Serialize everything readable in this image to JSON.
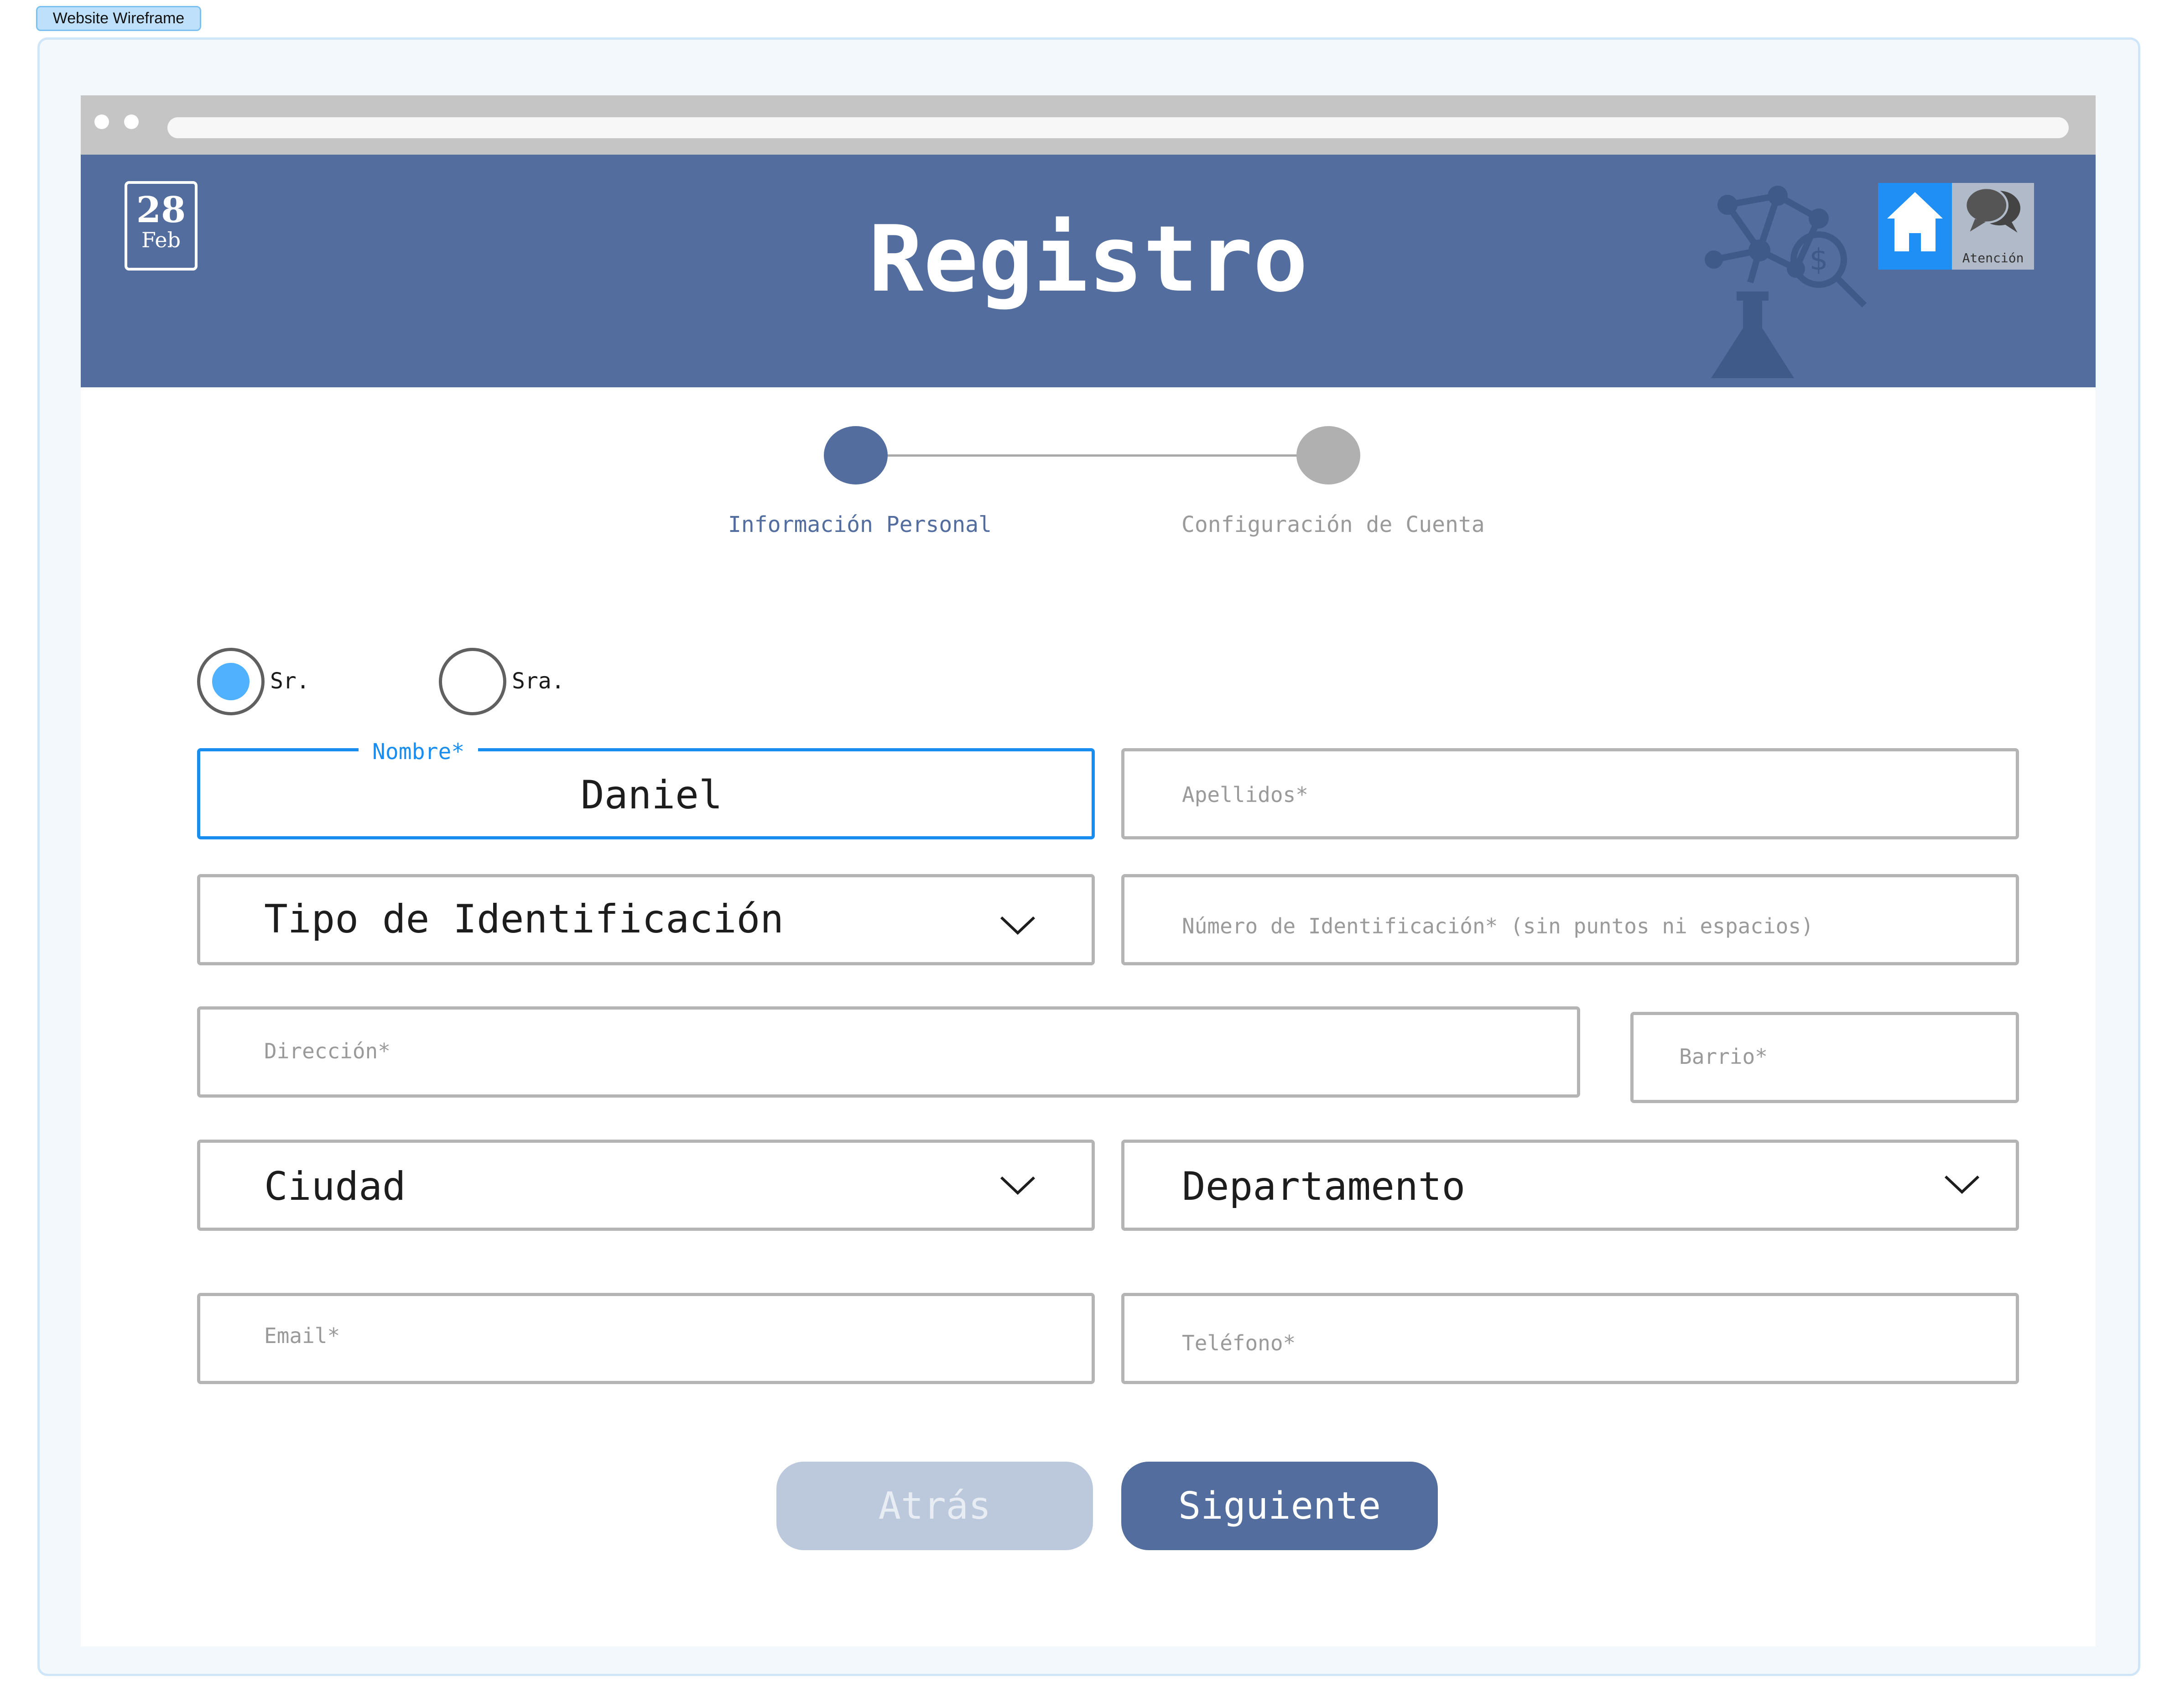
{
  "frame": {
    "tag": "Website Wireframe"
  },
  "header": {
    "calendar": {
      "day": "28",
      "month": "Feb"
    },
    "title": "Registro",
    "nav": {
      "home_icon": "home-icon",
      "attention_label": "Atención",
      "attention_icon": "chat-bubbles-icon"
    }
  },
  "stepper": {
    "steps": [
      {
        "label": "Información Personal",
        "active": true
      },
      {
        "label": "Configuración de Cuenta",
        "active": false
      }
    ]
  },
  "form": {
    "salutation": {
      "options": [
        {
          "label": "Sr.",
          "selected": true
        },
        {
          "label": "Sra.",
          "selected": false
        }
      ]
    },
    "nombre": {
      "label": "Nombre*",
      "value": "Daniel"
    },
    "apellidos": {
      "placeholder": "Apellidos*"
    },
    "tipo_identificacion": {
      "value": "Tipo de Identificación"
    },
    "numero_identificacion": {
      "placeholder": "Número de Identificación* (sin puntos ni espacios)"
    },
    "direccion": {
      "placeholder": "Dirección*"
    },
    "barrio": {
      "placeholder": "Barrio*"
    },
    "ciudad": {
      "value": "Ciudad"
    },
    "departamento": {
      "value": "Departamento"
    },
    "email": {
      "placeholder": "Email*"
    },
    "telefono": {
      "placeholder": "Teléfono*"
    }
  },
  "actions": {
    "back": "Atrás",
    "next": "Siguiente"
  },
  "colors": {
    "primary": "#526d9e",
    "accent_blue": "#1a8ef0",
    "radio_fill": "#4fb1ff",
    "inactive_step": "#b0b0b0",
    "back_button": "#bcc8dc"
  }
}
